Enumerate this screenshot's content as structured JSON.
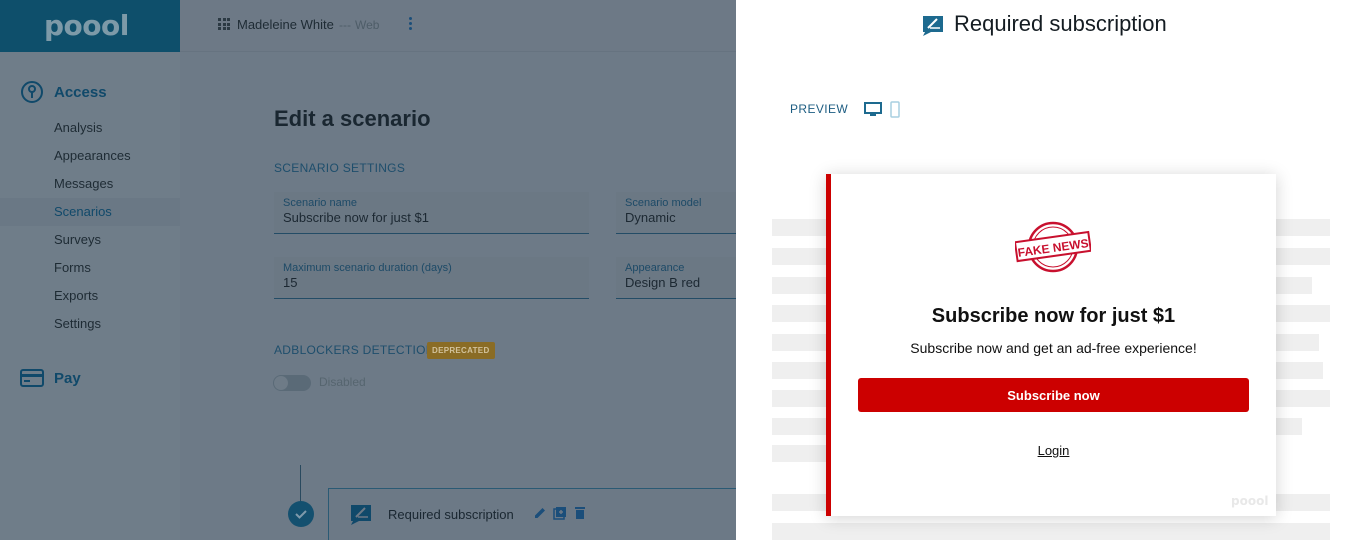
{
  "app": {
    "logo": "poool",
    "user": {
      "name": "Madeleine White",
      "separator": "---",
      "channel": "Web"
    }
  },
  "sidebar": {
    "access_label": "Access",
    "items": [
      {
        "label": "Analysis"
      },
      {
        "label": "Appearances"
      },
      {
        "label": "Messages"
      },
      {
        "label": "Scenarios",
        "active": true
      },
      {
        "label": "Surveys"
      },
      {
        "label": "Forms"
      },
      {
        "label": "Exports"
      },
      {
        "label": "Settings"
      }
    ],
    "pay_label": "Pay"
  },
  "main": {
    "title": "Edit a scenario",
    "settings_title": "SCENARIO SETTINGS",
    "fields": {
      "name": {
        "label": "Scenario name",
        "value": "Subscribe now for just $1"
      },
      "model": {
        "label": "Scenario model",
        "value": "Dynamic"
      },
      "duration": {
        "label": "Maximum scenario duration (days)",
        "value": "15"
      },
      "appearance": {
        "label": "Appearance",
        "value": "Design B red"
      }
    },
    "adblock": {
      "title": "ADBLOCKERS DETECTION",
      "badge": "DEPRECATED",
      "toggle_label": "Disabled",
      "enabled": false
    },
    "step": {
      "label": "Required subscription",
      "icon": "paywall-icon"
    }
  },
  "panel": {
    "title": "Required subscription",
    "preview_label": "PREVIEW",
    "devices": [
      "desktop-icon",
      "mobile-icon"
    ],
    "modal": {
      "stamp_text": "FAKE NEWS",
      "title": "Subscribe now for just $1",
      "subtitle": "Subscribe now and get an ad-free experience!",
      "cta_label": "Subscribe now",
      "login_label": "Login",
      "watermark": "poool"
    }
  },
  "colors": {
    "brand_dark": "#0e4f6b",
    "accent_blue": "#1d5d82",
    "cta_red": "#cc0000",
    "overlay": "#6e7c89"
  }
}
